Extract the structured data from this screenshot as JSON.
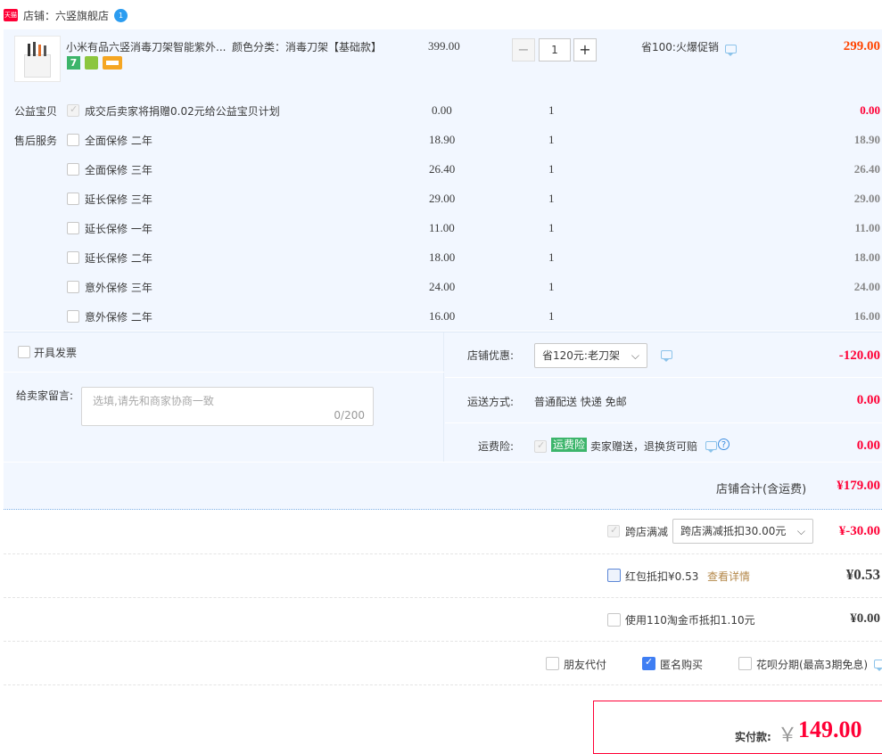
{
  "shop": {
    "badge": "天猫",
    "label": "店铺：六竖旗舰店",
    "msg_count": "1"
  },
  "item": {
    "title": "小米有品六竖消毒刀架智能紫外...",
    "spec": "颜色分类：消毒刀架【基础款】",
    "unit_price": "399.00",
    "qty": "1",
    "promo": "省100:火爆促销",
    "subtotal": "299.00",
    "badges": [
      "7",
      "🏅",
      "💳"
    ]
  },
  "charity": {
    "label": "公益宝贝",
    "text": "成交后卖家将捐赠0.02元给公益宝贝计划",
    "price": "0.00",
    "qty": "1",
    "total": "0.00"
  },
  "service_label": "售后服务",
  "services": [
    {
      "name": "全面保修 二年",
      "price": "18.90",
      "qty": "1",
      "total": "18.90"
    },
    {
      "name": "全面保修 三年",
      "price": "26.40",
      "qty": "1",
      "total": "26.40"
    },
    {
      "name": "延长保修 三年",
      "price": "29.00",
      "qty": "1",
      "total": "29.00"
    },
    {
      "name": "延长保修 一年",
      "price": "11.00",
      "qty": "1",
      "total": "11.00"
    },
    {
      "name": "延长保修 二年",
      "price": "18.00",
      "qty": "1",
      "total": "18.00"
    },
    {
      "name": "意外保修 三年",
      "price": "24.00",
      "qty": "1",
      "total": "24.00"
    },
    {
      "name": "意外保修 二年",
      "price": "16.00",
      "qty": "1",
      "total": "16.00"
    }
  ],
  "invoice": {
    "label": "开具发票"
  },
  "message": {
    "label": "给卖家留言:",
    "placeholder": "选填,请先和商家协商一致",
    "counter": "0/200"
  },
  "discount": {
    "label": "店铺优惠:",
    "selected": "省120元:老刀架",
    "amount": "-120.00"
  },
  "shipping": {
    "label": "运送方式:",
    "value": "普通配送 快递 免邮",
    "amount": "0.00"
  },
  "insurance": {
    "label": "运费险:",
    "tag": "运费险",
    "text": "卖家赠送，退换货可赔",
    "amount": "0.00"
  },
  "shop_total": {
    "label": "店铺合计(含运费)",
    "value": "¥179.00"
  },
  "cross_shop": {
    "label": "跨店满减",
    "selected": "跨店满减抵扣30.00元",
    "amount": "¥-30.00"
  },
  "red_packet": {
    "label": "红包抵扣¥0.53",
    "link": "查看详情",
    "amount": "¥0.53"
  },
  "coins": {
    "label": "使用110淘金币抵扣1.10元",
    "amount": "¥0.00"
  },
  "options": {
    "friend_pay": "朋友代付",
    "anonymous": "匿名购买",
    "huabei": "花呗分期(最高3期免息)"
  },
  "payment": {
    "label": "实付款:",
    "currency": "￥",
    "amount": "149.00"
  },
  "colors": {
    "accent_red": "#ff0036",
    "price_orange": "#ff4400",
    "panel_blue": "#f2f7ff",
    "checkbox_blue": "#3f7ef3"
  }
}
